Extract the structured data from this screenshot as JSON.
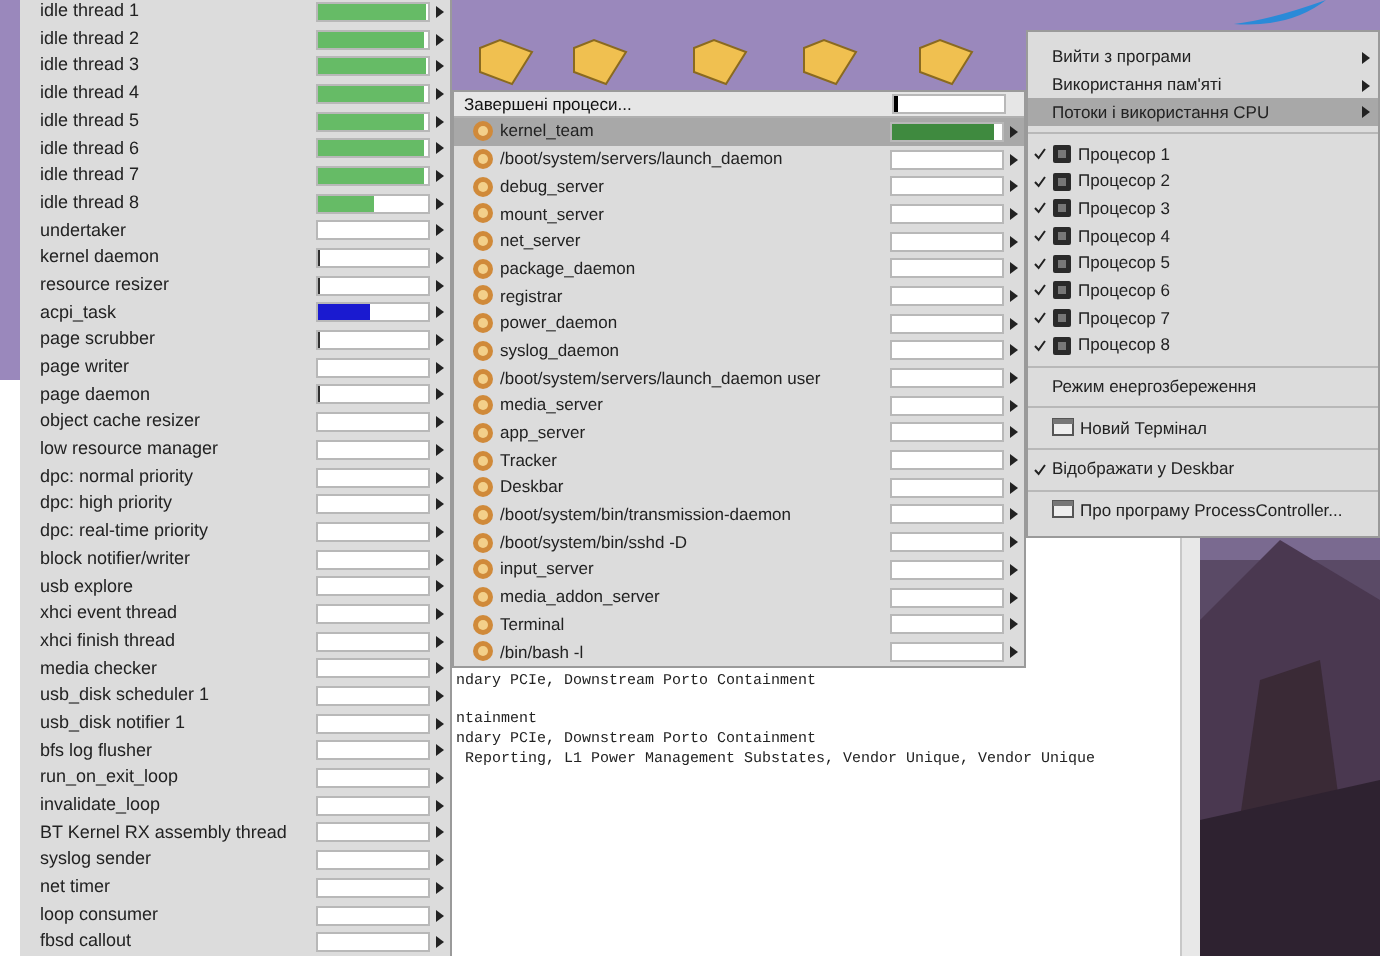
{
  "threads_menu": {
    "items": [
      {
        "label": "idle thread 1",
        "level": 0.98,
        "color": "#66bb66"
      },
      {
        "label": "idle thread 2",
        "level": 0.97,
        "color": "#66bb66"
      },
      {
        "label": "idle thread 3",
        "level": 0.98,
        "color": "#66bb66"
      },
      {
        "label": "idle thread 4",
        "level": 0.97,
        "color": "#66bb66"
      },
      {
        "label": "idle thread 5",
        "level": 0.97,
        "color": "#66bb66"
      },
      {
        "label": "idle thread 6",
        "level": 0.97,
        "color": "#66bb66"
      },
      {
        "label": "idle thread 7",
        "level": 0.97,
        "color": "#66bb66"
      },
      {
        "label": "idle thread 8",
        "level": 0.5,
        "color": "#66bb66"
      },
      {
        "label": "undertaker"
      },
      {
        "label": "kernel daemon",
        "level": 0.02,
        "color": "#303030"
      },
      {
        "label": "resource resizer",
        "level": 0.02,
        "color": "#303030"
      },
      {
        "label": "acpi_task",
        "level": 0.48,
        "color": "#1a1ad0"
      },
      {
        "label": "page scrubber",
        "level": 0.02,
        "color": "#303030"
      },
      {
        "label": "page writer"
      },
      {
        "label": "page daemon",
        "level": 0.02,
        "color": "#303030"
      },
      {
        "label": "object cache resizer"
      },
      {
        "label": "low resource manager"
      },
      {
        "label": "dpc: normal priority"
      },
      {
        "label": "dpc: high priority"
      },
      {
        "label": "dpc: real-time priority"
      },
      {
        "label": "block notifier/writer"
      },
      {
        "label": "usb explore"
      },
      {
        "label": "xhci event thread"
      },
      {
        "label": "xhci finish thread"
      },
      {
        "label": "media checker"
      },
      {
        "label": "usb_disk scheduler 1"
      },
      {
        "label": "usb_disk notifier 1"
      },
      {
        "label": "bfs log flusher"
      },
      {
        "label": "run_on_exit_loop"
      },
      {
        "label": "invalidate_loop"
      },
      {
        "label": "BT Kernel RX assembly thread"
      },
      {
        "label": "syslog sender"
      },
      {
        "label": "net timer"
      },
      {
        "label": "loop consumer"
      },
      {
        "label": "fbsd callout"
      }
    ]
  },
  "teams_menu": {
    "header": {
      "label": "Завершені процеси...",
      "level": 0.04,
      "color": "#000000"
    },
    "items": [
      {
        "label": "kernel_team",
        "selected": true,
        "level": 0.92,
        "color": "#3f8a3f"
      },
      {
        "label": "/boot/system/servers/launch_daemon",
        "selected": false
      },
      {
        "label": "debug_server",
        "selected": false
      },
      {
        "label": "mount_server",
        "selected": false
      },
      {
        "label": "net_server",
        "selected": false
      },
      {
        "label": "package_daemon",
        "selected": false
      },
      {
        "label": "registrar",
        "selected": false
      },
      {
        "label": "power_daemon",
        "selected": false
      },
      {
        "label": "syslog_daemon",
        "selected": false
      },
      {
        "label": "/boot/system/servers/launch_daemon user",
        "selected": false
      },
      {
        "label": "media_server",
        "selected": false
      },
      {
        "label": "app_server",
        "selected": false
      },
      {
        "label": "Tracker",
        "selected": false
      },
      {
        "label": "Deskbar",
        "selected": false
      },
      {
        "label": "/boot/system/bin/transmission-daemon",
        "selected": false
      },
      {
        "label": "/boot/system/bin/sshd -D",
        "selected": false
      },
      {
        "label": "input_server",
        "selected": false
      },
      {
        "label": "media_addon_server",
        "selected": false
      },
      {
        "label": "Terminal",
        "selected": false
      },
      {
        "label": "/bin/bash -l",
        "selected": false
      }
    ]
  },
  "main_menu": {
    "sections": [
      [
        {
          "label": "Вийти з програми",
          "kind": "submenu",
          "selected": false
        },
        {
          "label": "Використання пам'яті",
          "kind": "submenu",
          "selected": false
        },
        {
          "label": "Потоки і використання CPU",
          "kind": "submenu",
          "selected": true
        }
      ],
      [
        {
          "label": "Процесор 1",
          "kind": "cpu",
          "checked": true,
          "selected": false
        },
        {
          "label": "Процесор 2",
          "kind": "cpu",
          "checked": true,
          "selected": false
        },
        {
          "label": "Процесор 3",
          "kind": "cpu",
          "checked": true,
          "selected": false
        },
        {
          "label": "Процесор 4",
          "kind": "cpu",
          "checked": true,
          "selected": false
        },
        {
          "label": "Процесор 5",
          "kind": "cpu",
          "checked": true,
          "selected": false
        },
        {
          "label": "Процесор 6",
          "kind": "cpu",
          "checked": true,
          "selected": false
        },
        {
          "label": "Процесор 7",
          "kind": "cpu",
          "checked": true,
          "selected": false
        },
        {
          "label": "Процесор 8",
          "kind": "cpu",
          "checked": true,
          "selected": false
        }
      ],
      [
        {
          "label": "Режим енергозбереження",
          "kind": "check",
          "checked": false,
          "selected": false
        }
      ],
      [
        {
          "label": "Новий Термінал",
          "kind": "action",
          "selected": false
        }
      ],
      [
        {
          "label": "Відображати у Deskbar",
          "kind": "check",
          "checked": true,
          "selected": false
        }
      ],
      [
        {
          "label": "Про програму ProcessController...",
          "kind": "action",
          "selected": false
        }
      ]
    ]
  },
  "terminal": {
    "blocks": [
      [
        "ndary PCIe, Downstream Porto Containment"
      ],
      [
        "ntainment",
        "ndary PCIe, Downstream Porto Containment",
        " Reporting, L1 Power Management Substates, Vendor Unique, Vendor Unique"
      ]
    ]
  }
}
